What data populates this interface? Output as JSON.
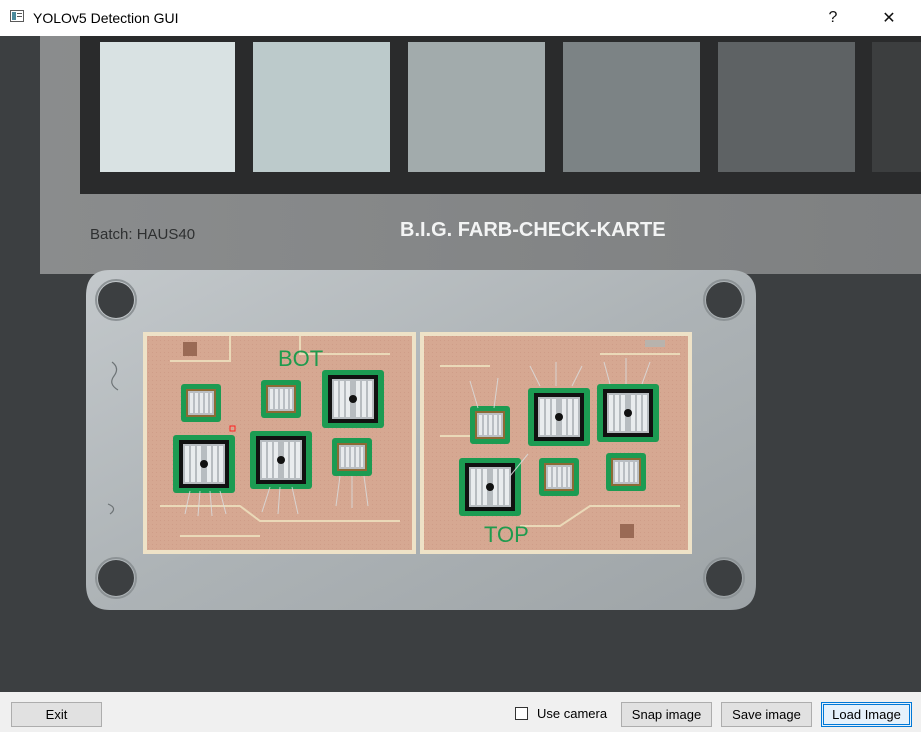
{
  "window": {
    "title": "YOLOv5 Detection GUI",
    "help_label": "?",
    "close_label": "✕"
  },
  "image": {
    "batch_text": "Batch: HAUS40",
    "card_title": "B.I.G. FARB-CHECK-KARTE",
    "board_label_left": "BOT",
    "board_label_right": "TOP",
    "colors": {
      "background": "#3b3e40",
      "card": "#8d8f90",
      "pcb": "#d8a894",
      "trace_green": "#1d9c52",
      "trace_gold": "#e8d7b0"
    }
  },
  "bottom": {
    "exit_label": "Exit",
    "use_camera_label": "Use camera",
    "use_camera_checked": false,
    "snap_label": "Snap image",
    "save_label": "Save image",
    "load_label": "Load Image"
  }
}
